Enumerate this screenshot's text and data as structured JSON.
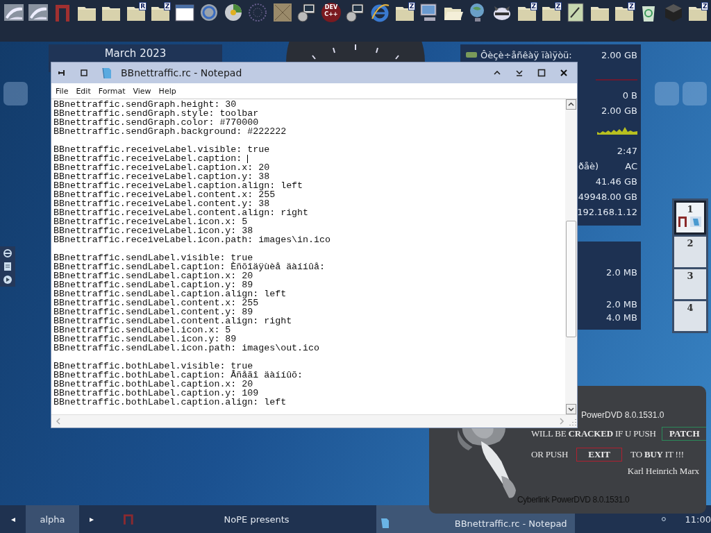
{
  "launcher": [
    {
      "kind": "logo"
    },
    {
      "kind": "logo"
    },
    {
      "kind": "arch"
    },
    {
      "kind": "folder"
    },
    {
      "kind": "folder"
    },
    {
      "kind": "folder",
      "label": "R"
    },
    {
      "kind": "folder",
      "label": "Z"
    },
    {
      "kind": "window"
    },
    {
      "kind": "ring"
    },
    {
      "kind": "disc"
    },
    {
      "kind": "web"
    },
    {
      "kind": "box"
    },
    {
      "kind": "setup"
    },
    {
      "kind": "badge",
      "label": "DEV C++"
    },
    {
      "kind": "setup"
    },
    {
      "kind": "ie"
    },
    {
      "kind": "folder",
      "label": "Z"
    },
    {
      "kind": "computer"
    },
    {
      "kind": "openfolder"
    },
    {
      "kind": "globe"
    },
    {
      "kind": "animal"
    },
    {
      "kind": "folder",
      "label": "Z"
    },
    {
      "kind": "folder",
      "label": "Z"
    },
    {
      "kind": "notepad"
    },
    {
      "kind": "folder"
    },
    {
      "kind": "folder",
      "label": "Z"
    },
    {
      "kind": "recycle"
    },
    {
      "kind": "cube"
    },
    {
      "kind": "folder",
      "label": "Z"
    }
  ],
  "calendar": {
    "title": "March 2023"
  },
  "system_monitor": {
    "rows": [
      {
        "kind": "text",
        "label": "Ôèçè÷åñêàÿ ïàìÿòü:",
        "value": "2.00 GB"
      },
      {
        "kind": "line"
      },
      {
        "kind": "text",
        "value": "0 B"
      },
      {
        "kind": "text",
        "value": "2.00 GB"
      },
      {
        "kind": "graph"
      },
      {
        "kind": "text",
        "value": "2:47"
      },
      {
        "kind": "text",
        "label": "ðåè)",
        "value": "AC"
      },
      {
        "kind": "text",
        "value": "41.46 GB"
      },
      {
        "kind": "text",
        "value": "49948.00 GB"
      },
      {
        "kind": "text",
        "value": "192.168.1.12"
      }
    ]
  },
  "memory_panel": {
    "values": [
      "2.0 MB",
      "2.0 MB",
      "4.0 MB"
    ]
  },
  "pager": {
    "desks": [
      {
        "label": "1",
        "selected": true
      },
      {
        "label": "2",
        "selected": false
      },
      {
        "label": "3",
        "selected": false
      },
      {
        "label": "4",
        "selected": false
      }
    ]
  },
  "notepad": {
    "title": "BBnettraffic.rc - Notepad",
    "menu": [
      "File",
      "Edit",
      "Format",
      "View",
      "Help"
    ],
    "paragraphs": [
      {
        "lines": [
          {
            "text": "BBnettraffic.sendGraph.height: 30"
          },
          {
            "text": "BBnettraffic.sendGraph.style: toolbar"
          },
          {
            "text": "BBnettraffic.sendGraph.color: #770000"
          },
          {
            "text": "BBnettraffic.sendGraph.background: #222222"
          }
        ]
      },
      {
        "lines": [
          {
            "text": "BBnettraffic.receiveLabel.visible: true"
          },
          {
            "text": "BBnettraffic.receiveLabel.caption: ",
            "cursor": true
          },
          {
            "text": "BBnettraffic.receiveLabel.caption.x: 20"
          },
          {
            "text": "BBnettraffic.receiveLabel.caption.y: 38"
          },
          {
            "text": "BBnettraffic.receiveLabel.caption.align: left"
          },
          {
            "text": "BBnettraffic.receiveLabel.content.x: 255"
          },
          {
            "text": "BBnettraffic.receiveLabel.content.y: 38"
          },
          {
            "text": "BBnettraffic.receiveLabel.content.align: right"
          },
          {
            "text": "BBnettraffic.receiveLabel.icon.x: 5"
          },
          {
            "text": "BBnettraffic.receiveLabel.icon.y: 38"
          },
          {
            "text": "BBnettraffic.receiveLabel.icon.path: images\\in.ico"
          }
        ]
      },
      {
        "lines": [
          {
            "text": "BBnettraffic.sendLabel.visible: true"
          },
          {
            "text": "BBnettraffic.sendLabel.caption: Èñõîäÿùèå äàííûå:"
          },
          {
            "text": "BBnettraffic.sendLabel.caption.x: 20"
          },
          {
            "text": "BBnettraffic.sendLabel.caption.y: 89"
          },
          {
            "text": "BBnettraffic.sendLabel.caption.align: left"
          },
          {
            "text": "BBnettraffic.sendLabel.content.x: 255"
          },
          {
            "text": "BBnettraffic.sendLabel.content.y: 89"
          },
          {
            "text": "BBnettraffic.sendLabel.content.align: right"
          },
          {
            "text": "BBnettraffic.sendLabel.icon.x: 5"
          },
          {
            "text": "BBnettraffic.sendLabel.icon.y: 89"
          },
          {
            "text": "BBnettraffic.sendLabel.icon.path: images\\out.ico"
          }
        ]
      },
      {
        "lines": [
          {
            "text": "BBnettraffic.bothLabel.visible: true"
          },
          {
            "text": "BBnettraffic.bothLabel.caption: Âñåãî äàííûõ:"
          },
          {
            "text": "BBnettraffic.bothLabel.caption.x: 20"
          },
          {
            "text": "BBnettraffic.bothLabel.caption.y: 109"
          },
          {
            "text": "BBnettraffic.bothLabel.caption.align: left"
          }
        ]
      }
    ]
  },
  "dialog": {
    "version": "PowerDVD 8.0.1531.0",
    "line_1": "WILL BE **CRACKED** IF U PUSH",
    "patch_button": "PATCH",
    "line_2": "OR PUSH",
    "exit_button": "EXIT",
    "line_3": "TO **BUY** IT  !!!",
    "author": "Karl Heinrich Marx",
    "footer": "Cyberlink PowerDVD 8.0.1531.0"
  },
  "taskbar": {
    "prev": "◂",
    "workspace": "alpha",
    "next": "▸",
    "tray_text": "NoPE presents",
    "tasks": [
      {
        "title": "BBnettraffic.rc - Notepad",
        "selected": true
      }
    ],
    "clock": "11:00"
  }
}
